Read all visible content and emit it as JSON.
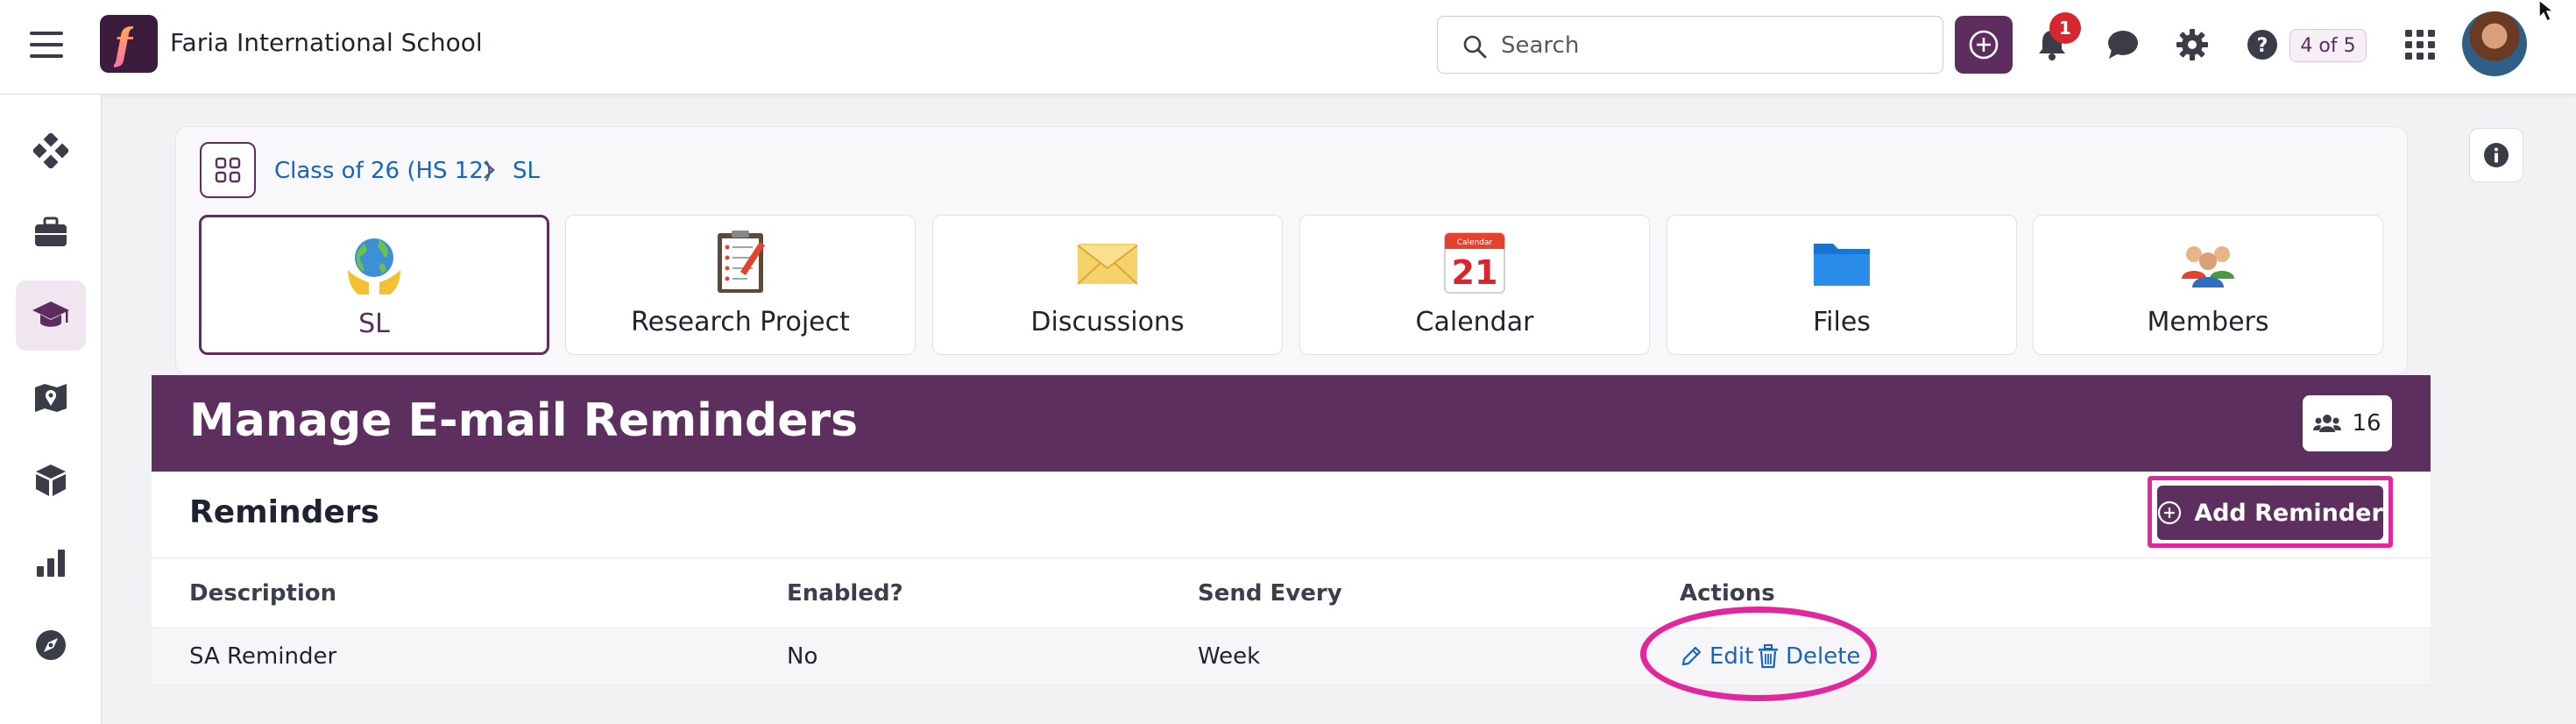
{
  "app": {
    "school_name": "Faria International School",
    "logo_letter": "f",
    "search_placeholder": "Search",
    "notification_count": "1",
    "counter": "4 of 5"
  },
  "breadcrumb": [
    "Class of 26 (HS 12)",
    "SL"
  ],
  "tiles": [
    {
      "label": "SL",
      "icon": "globe-hands-icon",
      "active": true
    },
    {
      "label": "Research Project",
      "icon": "clipboard-icon",
      "active": false
    },
    {
      "label": "Discussions",
      "icon": "envelope-icon",
      "active": false
    },
    {
      "label": "Calendar",
      "icon": "calendar-icon",
      "active": false,
      "icon_text": "21",
      "icon_header": "Calendar"
    },
    {
      "label": "Files",
      "icon": "folder-icon",
      "active": false
    },
    {
      "label": "Members",
      "icon": "people-icon",
      "active": false
    }
  ],
  "page": {
    "title": "Manage E-mail Reminders",
    "members_count": "16",
    "section_title": "Reminders",
    "add_button": "Add Reminder"
  },
  "table": {
    "columns": [
      "Description",
      "Enabled?",
      "Send Every",
      "Actions"
    ],
    "rows": [
      {
        "description": "SA Reminder",
        "enabled": "No",
        "send_every": "Week",
        "edit": "Edit",
        "delete": "Delete"
      }
    ]
  },
  "colors": {
    "brand": "#5c2f5e",
    "link": "#1565c0",
    "highlight": "#e0279b",
    "badge": "#d7262e"
  }
}
